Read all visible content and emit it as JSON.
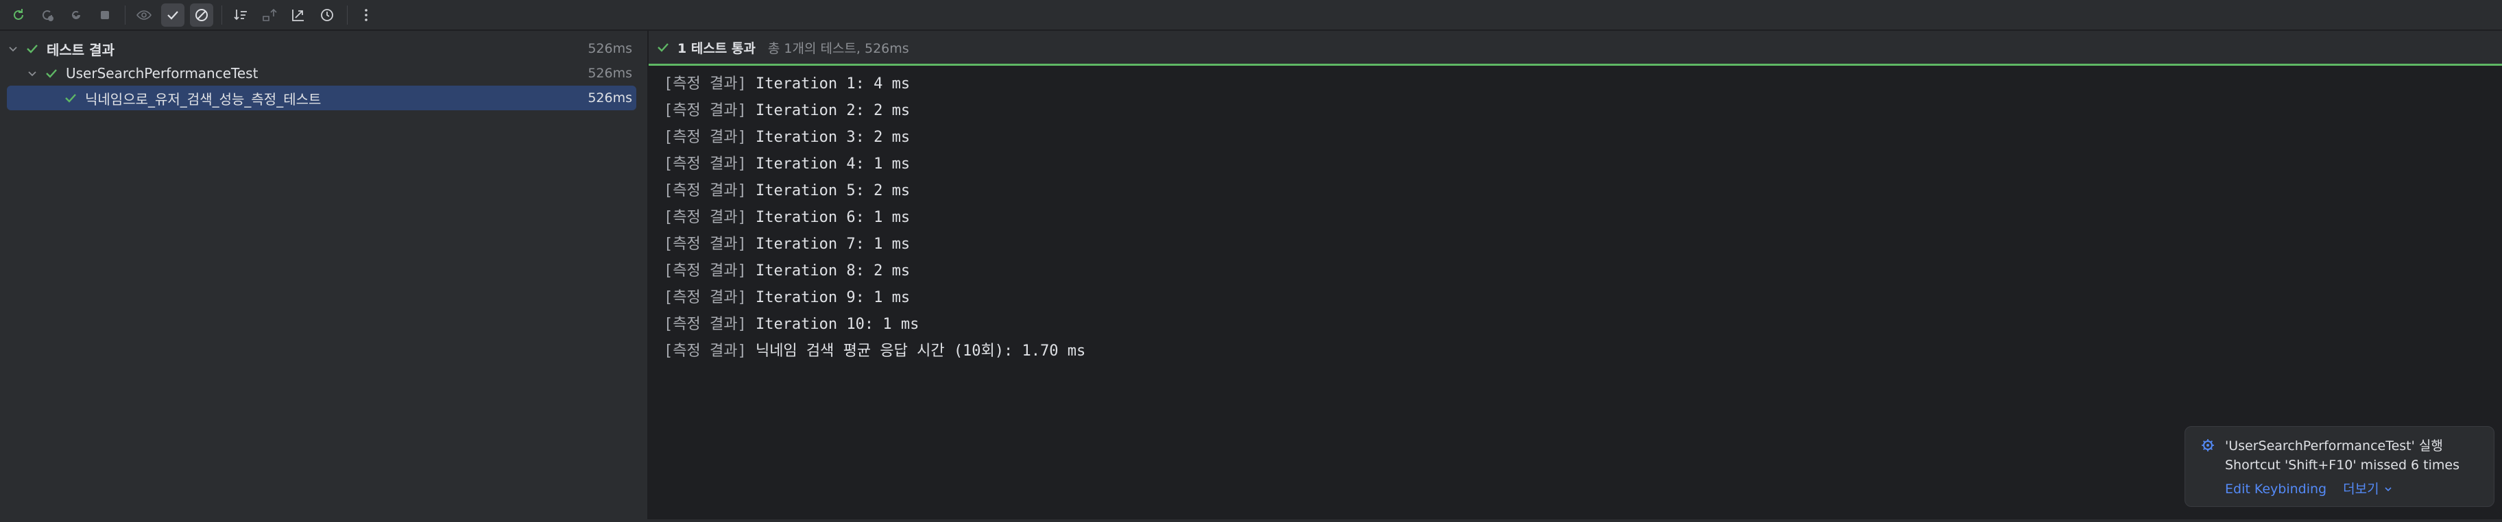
{
  "toolbar": {
    "buttons": [
      {
        "icon": "rerun-icon"
      },
      {
        "icon": "rerun-failed-icon"
      },
      {
        "icon": "toggle-auto-test-icon"
      },
      {
        "icon": "stop-icon"
      },
      {
        "icon": "show-passed-icon"
      },
      {
        "icon": "show-ignored-icon"
      },
      {
        "icon": "sort-icon"
      },
      {
        "icon": "import-tests-icon"
      },
      {
        "icon": "export-icon"
      },
      {
        "icon": "history-icon"
      },
      {
        "icon": "more-options-icon"
      }
    ]
  },
  "tree": {
    "root": {
      "label": "테스트 결과",
      "time": "526ms"
    },
    "class": {
      "label": "UserSearchPerformanceTest",
      "time": "526ms"
    },
    "method": {
      "label": "닉네임으로_유저_검색_성능_측정_테스트",
      "time": "526ms"
    }
  },
  "status": {
    "title": "1 테스트 통과",
    "detail": "총 1개의 테스트, 526ms",
    "color": "#5fb865"
  },
  "log": {
    "lines": [
      {
        "prefix": "[측정 결과]",
        "text": " Iteration 1: 4 ms"
      },
      {
        "prefix": "[측정 결과]",
        "text": " Iteration 2: 2 ms"
      },
      {
        "prefix": "[측정 결과]",
        "text": " Iteration 3: 2 ms"
      },
      {
        "prefix": "[측정 결과]",
        "text": " Iteration 4: 1 ms"
      },
      {
        "prefix": "[측정 결과]",
        "text": " Iteration 5: 2 ms"
      },
      {
        "prefix": "[측정 결과]",
        "text": " Iteration 6: 1 ms"
      },
      {
        "prefix": "[측정 결과]",
        "text": " Iteration 7: 1 ms"
      },
      {
        "prefix": "[측정 결과]",
        "text": " Iteration 8: 2 ms"
      },
      {
        "prefix": "[측정 결과]",
        "text": " Iteration 9: 1 ms"
      },
      {
        "prefix": "[측정 결과]",
        "text": " Iteration 10: 1 ms"
      },
      {
        "prefix": "[측정 결과]",
        "text": " 닉네임 검색 평균 응답 시간 (10회): 1.70 ms"
      }
    ]
  },
  "notification": {
    "title": "'UserSearchPerformanceTest' 실행",
    "subtitle": "Shortcut 'Shift+F10' missed 6 times",
    "action_label": "Edit Keybinding",
    "more_label": "더보기"
  },
  "colors": {
    "accent_green": "#5fb865",
    "link_blue": "#548af7",
    "selection": "#2e436e"
  }
}
